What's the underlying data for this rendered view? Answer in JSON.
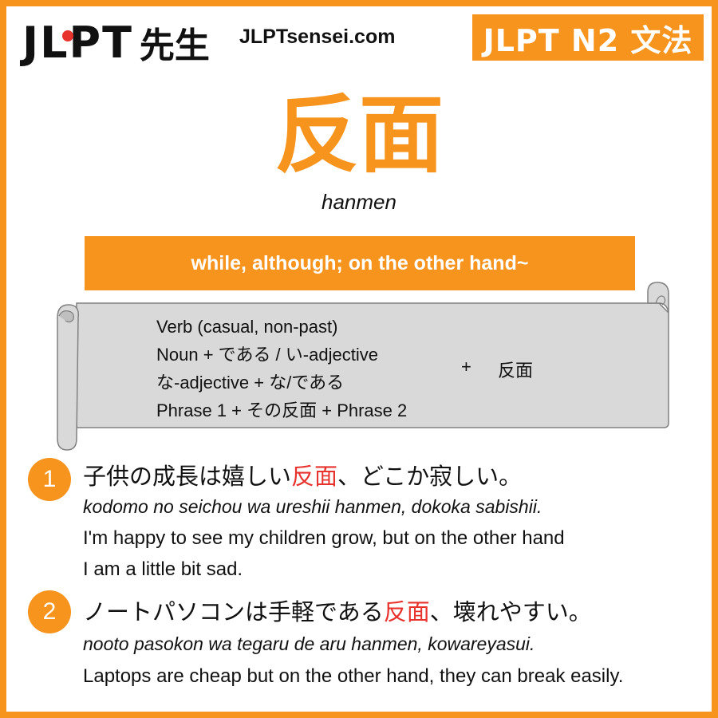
{
  "header": {
    "logo_latin": "JLPT",
    "logo_kanji": "先生",
    "site": "JLPTsensei.com",
    "level_badge": "JLPT N2 文法"
  },
  "grammar": {
    "title": "反面",
    "romaji": "hanmen",
    "meaning": "while, although; on the other hand~"
  },
  "formation": {
    "lines": [
      "Verb (casual, non-past)",
      "Noun + である / い-adjective",
      "な-adjective + な/である",
      "Phrase 1 + その反面 + Phrase 2"
    ],
    "plus": "+",
    "suffix": "反面"
  },
  "examples": [
    {
      "number": "1",
      "jp_before": "子供の成長は嬉しい",
      "jp_highlight": "反面",
      "jp_after": "、どこか寂しい。",
      "romaji": "kodomo no seichou wa ureshii hanmen, dokoka sabishii.",
      "en_line1": "I'm happy to see my children grow, but on the other hand",
      "en_line2": "I am a little bit sad."
    },
    {
      "number": "2",
      "jp_before": "ノートパソコンは手軽である",
      "jp_highlight": "反面",
      "jp_after": "、壊れやすい。",
      "romaji": "nooto pasokon wa tegaru de aru hanmen, kowareyasui.",
      "en_line1": "Laptops are cheap but on the other hand, they can break easily."
    }
  ],
  "colors": {
    "accent": "#f7941d",
    "highlight": "#e8322c",
    "scroll_fill": "#d9d9d9"
  }
}
